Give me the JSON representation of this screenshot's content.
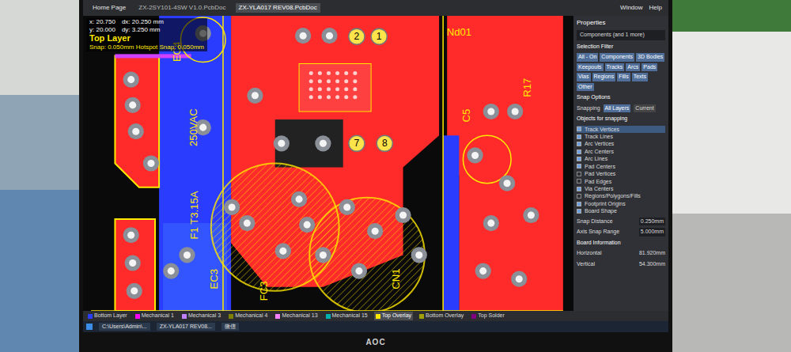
{
  "window": {
    "home": "Home Page",
    "menu": [
      "Window",
      "Help"
    ],
    "tabs": [
      {
        "label": "ZX-2SY101-4SW V1.0.PcbDoc",
        "selected": false
      },
      {
        "label": "ZX-YLA017 REV08.PcbDoc",
        "selected": true
      }
    ]
  },
  "hud": {
    "x": "x: 20.750",
    "dx": "dx: 20.250 mm",
    "y": "y: 20.000",
    "dy": "dy: 3.250 mm",
    "layer": "Top Layer",
    "snap": "Snap: 0.050mm Hotspot Snap: 0.050mm"
  },
  "silkscreen": [
    {
      "text": "EC4"
    },
    {
      "text": "250VAC"
    },
    {
      "text": "F1 T3.15A"
    },
    {
      "text": "EC3"
    },
    {
      "text": "FC3"
    },
    {
      "text": "C5"
    },
    {
      "text": "R17"
    },
    {
      "text": "Nd01"
    },
    {
      "text": "CN1"
    }
  ],
  "pads": [
    {
      "label": "2"
    },
    {
      "label": "1"
    },
    {
      "label": "7"
    },
    {
      "label": "8"
    }
  ],
  "properties": {
    "title": "Properties",
    "filter": "Components (and 1 more)",
    "selection_filter": "Selection Filter",
    "filter_buttons": [
      {
        "label": "All - On",
        "selected": true
      },
      {
        "label": "Components",
        "selected": true
      },
      {
        "label": "3D Bodies",
        "selected": true
      },
      {
        "label": "Keepouts",
        "selected": true
      },
      {
        "label": "Tracks",
        "selected": true
      },
      {
        "label": "Arcs",
        "selected": true
      },
      {
        "label": "Pads",
        "selected": true
      },
      {
        "label": "Vias",
        "selected": true
      },
      {
        "label": "Regions",
        "selected": true
      },
      {
        "label": "Fills",
        "selected": true
      },
      {
        "label": "Texts",
        "selected": true
      },
      {
        "label": "Other",
        "selected": true
      }
    ],
    "snap_title": "Snap Options",
    "snapping": "Snapping",
    "snap_modes": [
      {
        "label": "All Layers",
        "selected": true
      },
      {
        "label": "Current",
        "selected": false
      }
    ],
    "objects_title": "Objects for snapping",
    "objects": [
      {
        "label": "Track Vertices",
        "checked": true,
        "selected": true
      },
      {
        "label": "Track Lines",
        "checked": true,
        "selected": false
      },
      {
        "label": "Arc Vertices",
        "checked": true,
        "selected": false
      },
      {
        "label": "Arc Centers",
        "checked": true,
        "selected": false
      },
      {
        "label": "Arc Lines",
        "checked": true,
        "selected": false
      },
      {
        "label": "Pad Centers",
        "checked": true,
        "selected": false
      },
      {
        "label": "Pad Vertices",
        "checked": false,
        "selected": false
      },
      {
        "label": "Pad Edges",
        "checked": false,
        "selected": false
      },
      {
        "label": "Via Centers",
        "checked": true,
        "selected": false
      },
      {
        "label": "Regions/Polygons/Fills",
        "checked": false,
        "selected": false
      },
      {
        "label": "Footprint Origins",
        "checked": true,
        "selected": false
      },
      {
        "label": "Board Shape",
        "checked": true,
        "selected": false
      }
    ],
    "fields": [
      {
        "label": "Snap Distance",
        "value": "0.250mm"
      },
      {
        "label": "Axis Snap Range",
        "value": "5.000mm"
      }
    ],
    "board_title": "Board Information",
    "board": [
      {
        "label": "Horizontal",
        "value": "81.920mm"
      },
      {
        "label": "Vertical",
        "value": "54.300mm"
      }
    ]
  },
  "layer_tabs": [
    {
      "label": "Bottom Layer",
      "color": "#2a3dff",
      "selected": false
    },
    {
      "label": "Mechanical 1",
      "color": "#ff00ff",
      "selected": false
    },
    {
      "label": "Mechanical 3",
      "color": "#c080ff",
      "selected": false
    },
    {
      "label": "Mechanical 4",
      "color": "#808000",
      "selected": false
    },
    {
      "label": "Mechanical 13",
      "color": "#ff80ff",
      "selected": false
    },
    {
      "label": "Mechanical 15",
      "color": "#00b0b0",
      "selected": false
    },
    {
      "label": "Top Overlay",
      "color": "#ffe800",
      "selected": true
    },
    {
      "label": "Bottom Overlay",
      "color": "#a0a000",
      "selected": false
    },
    {
      "label": "Top Solder",
      "color": "#800080",
      "selected": false
    }
  ],
  "taskbar": [
    "C:\\Users\\Admin\\...",
    "ZX-YLA017 REV08...",
    "微信"
  ],
  "monitor": {
    "brand": "AOC"
  }
}
